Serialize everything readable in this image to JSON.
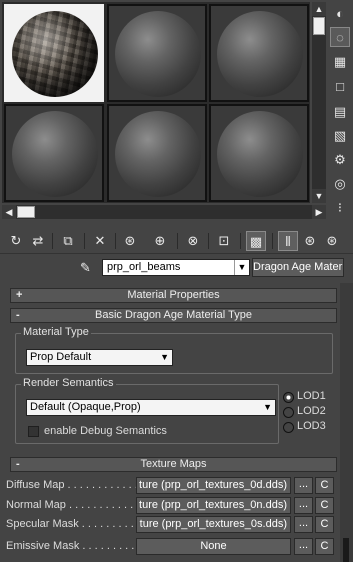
{
  "toolbar_icons": [
    "get-material-icon",
    "put-to-scene-icon",
    "assign-to-selection-icon",
    "reset-icon",
    "make-unique-icon",
    "put-to-library-icon",
    "material-id-icon",
    "show-map-icon",
    "show-end-result-icon",
    "go-to-parent-icon",
    "go-forward-icon"
  ],
  "side_icons": [
    "sample-type-icon",
    "backlight-icon",
    "background-icon",
    "sample-uv-icon",
    "video-check-icon",
    "make-preview-icon",
    "options-icon",
    "select-by-material-icon",
    "material-navigator-icon"
  ],
  "material": {
    "name": "prp_orl_beams",
    "type_button": "Dragon Age Material"
  },
  "rollouts": {
    "material_properties": {
      "sign": "+",
      "label": "Material Properties"
    },
    "basic_type": {
      "sign": "-",
      "label": "Basic Dragon Age Material Type"
    },
    "texture_maps": {
      "sign": "-",
      "label": "Texture Maps"
    }
  },
  "material_type": {
    "group_label": "Material Type",
    "selected": "Prop Default"
  },
  "render_semantics": {
    "group_label": "Render Semantics",
    "selected": "Default (Opaque,Prop)",
    "lods": [
      "LOD1",
      "LOD2",
      "LOD3"
    ],
    "selected_lod": "LOD1",
    "debug_label": "enable Debug Semantics",
    "debug_checked": false
  },
  "texture_maps": [
    {
      "label": "Diffuse Map . . . . . . . . . . . .",
      "value": "ture (prp_orl_textures_0d.dds)",
      "dots": "...",
      "c": "C"
    },
    {
      "label": "Normal Map . . . . . . . . . . . .",
      "value": "ture (prp_orl_textures_0n.dds)",
      "dots": "...",
      "c": "C"
    },
    {
      "label": "Specular Mask . . . . . . . . . .",
      "value": "ture (prp_orl_textures_0s.dds)",
      "dots": "...",
      "c": "C"
    },
    {
      "label": "Emissive Mask . . . . . . . . . .",
      "value": "None",
      "dots": "...",
      "c": "C"
    }
  ],
  "colors": {
    "panel_bg": "#444444",
    "slot_active": "#f2f2f2"
  }
}
